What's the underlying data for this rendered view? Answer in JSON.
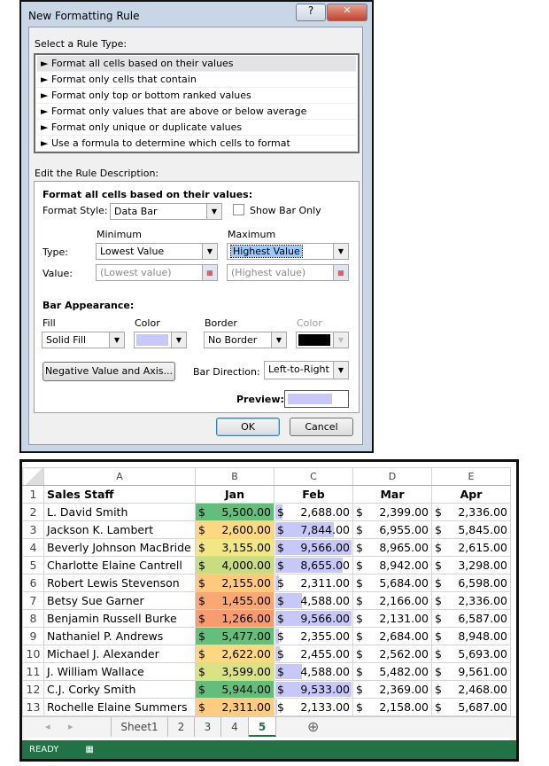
{
  "dialog": {
    "title": "New Formatting Rule",
    "help_label": "?",
    "close_label": "✕",
    "select_rule_type_label": "Select a Rule Type:",
    "rule_types": [
      "Format all cells based on their values",
      "Format only cells that contain",
      "Format only top or bottom ranked values",
      "Format only values that are above or below average",
      "Format only unique or duplicate values",
      "Use a formula to determine which cells to format"
    ],
    "rule_bullet": "►",
    "edit_description_label": "Edit the Rule Description:",
    "desc_heading": "Format all cells based on their values:",
    "format_style_label": "Format Style:",
    "format_style_value": "Data Bar",
    "show_bar_only_label": "Show Bar Only",
    "show_bar_only_checked": false,
    "minimum_label": "Minimum",
    "maximum_label": "Maximum",
    "type_label": "Type:",
    "value_label": "Value:",
    "min_type": "Lowest Value",
    "max_type": "Highest Value",
    "min_value_placeholder": "(Lowest value)",
    "max_value_placeholder": "(Highest value)",
    "bar_appearance_label": "Bar Appearance:",
    "fill_label": "Fill",
    "fill_value": "Solid Fill",
    "fill_color_label": "Color",
    "fill_color": "#c8c8f8",
    "border_label": "Border",
    "border_value": "No Border",
    "border_color_label": "Color",
    "border_color": "#000000",
    "negative_button": "Negative Value and Axis...",
    "bar_direction_label": "Bar Direction:",
    "bar_direction_value": "Left-to-Right",
    "preview_label": "Preview:",
    "ok": "OK",
    "cancel": "Cancel"
  },
  "sheet": {
    "columns": [
      "A",
      "B",
      "C",
      "D",
      "E"
    ],
    "headers": [
      "Sales Staff",
      "Jan",
      "Feb",
      "Mar",
      "Apr"
    ],
    "currency": "$",
    "rows": [
      {
        "n": "2",
        "name": "L. David Smith",
        "vals": [
          "5,500.00",
          "2,688.00",
          "2,399.00",
          "2,336.00"
        ],
        "jan_color": "#63be7b",
        "feb": 2688
      },
      {
        "n": "3",
        "name": "Jackson K. Lambert",
        "vals": [
          "2,600.00",
          "7,844.00",
          "6,955.00",
          "5,845.00"
        ],
        "jan_color": "#fed880",
        "feb": 7844
      },
      {
        "n": "4",
        "name": "Beverly Johnson MacBride",
        "vals": [
          "3,155.00",
          "9,566.00",
          "8,965.00",
          "2,615.00"
        ],
        "jan_color": "#f1e784",
        "feb": 9566
      },
      {
        "n": "5",
        "name": "Charlotte Elaine Cantrell",
        "vals": [
          "4,000.00",
          "8,655.00",
          "8,942.00",
          "3,298.00"
        ],
        "jan_color": "#c8dc81",
        "feb": 8655
      },
      {
        "n": "6",
        "name": "Robert Lewis Stevenson",
        "vals": [
          "2,155.00",
          "2,311.00",
          "5,684.00",
          "6,598.00"
        ],
        "jan_color": "#fdc97d",
        "feb": 2311
      },
      {
        "n": "7",
        "name": "Betsy Sue Garner",
        "vals": [
          "1,455.00",
          "4,588.00",
          "2,166.00",
          "2,336.00"
        ],
        "jan_color": "#f9a873",
        "feb": 4588
      },
      {
        "n": "8",
        "name": "Benjamin Russell Burke",
        "vals": [
          "1,266.00",
          "9,566.00",
          "2,131.00",
          "6,587.00"
        ],
        "jan_color": "#f89c70",
        "feb": 9566
      },
      {
        "n": "9",
        "name": "Nathaniel P. Andrews",
        "vals": [
          "5,477.00",
          "2,355.00",
          "2,684.00",
          "8,948.00"
        ],
        "jan_color": "#65bf7b",
        "feb": 2355
      },
      {
        "n": "10",
        "name": "Michael J. Alexander",
        "vals": [
          "2,622.00",
          "2,455.00",
          "2,562.00",
          "5,693.00"
        ],
        "jan_color": "#fed880",
        "feb": 2455
      },
      {
        "n": "11",
        "name": "J. William Wallace",
        "vals": [
          "3,599.00",
          "4,588.00",
          "5,482.00",
          "9,561.00"
        ],
        "jan_color": "#dbe283",
        "feb": 4588
      },
      {
        "n": "12",
        "name": "C.J. Corky Smith",
        "vals": [
          "5,944.00",
          "9,533.00",
          "2,369.00",
          "2,468.00"
        ],
        "jan_color": "#63be7b",
        "feb": 9533
      },
      {
        "n": "13",
        "name": "Rochelle Elaine Summers",
        "vals": [
          "2,311.00",
          "2,133.00",
          "2,158.00",
          "5,687.00"
        ],
        "jan_color": "#fdcc7e",
        "feb": 2133
      }
    ],
    "tabs": [
      "Sheet1",
      "2",
      "3",
      "4",
      "5"
    ],
    "active_tab": "5",
    "status": "READY",
    "accent": "#217346"
  }
}
